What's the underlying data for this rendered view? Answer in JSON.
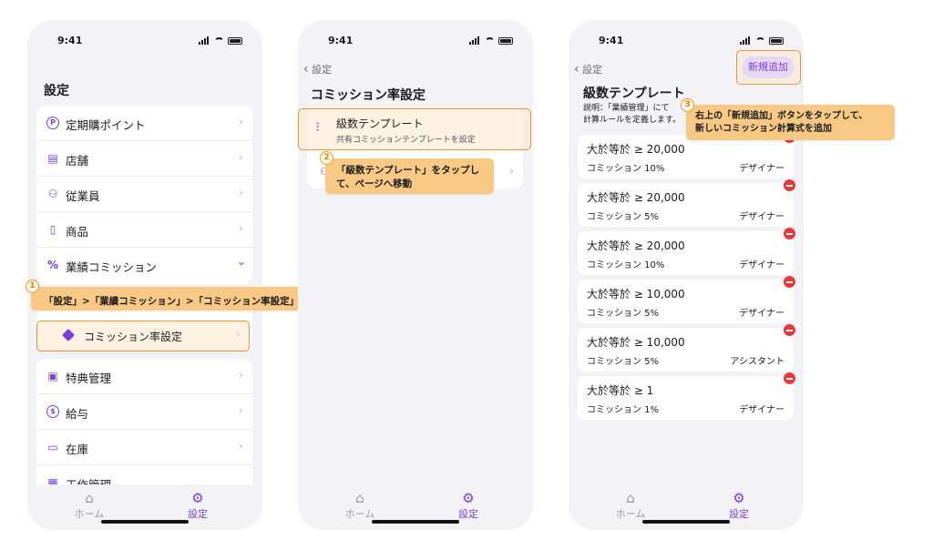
{
  "status_time": "9:41",
  "tabbar": {
    "home": "ホーム",
    "settings": "設定"
  },
  "screen1": {
    "title": "設定",
    "items": [
      {
        "icon": "points-icon",
        "label": "定期購ポイント"
      },
      {
        "icon": "store-icon",
        "label": "店舗"
      },
      {
        "icon": "staff-icon",
        "label": "従業員"
      },
      {
        "icon": "product-icon",
        "label": "商品"
      },
      {
        "icon": "percent-icon",
        "label": "業績コミッション"
      }
    ],
    "sub_item": "コミッション率設定",
    "items2": [
      {
        "icon": "benefit-icon",
        "label": "特典管理"
      },
      {
        "icon": "salary-icon",
        "label": "給与"
      },
      {
        "icon": "inventory-icon",
        "label": "在庫"
      },
      {
        "icon": "work-icon",
        "label": "工作管理"
      }
    ],
    "callout_num": "1",
    "callout": "「設定」>「業績コミッション」>「コミッション率設定」へ移動"
  },
  "screen2": {
    "back": "設定",
    "title": "コミッション率設定",
    "item_title": "級数テンプレート",
    "item_sub": "共有コミッションテンプレートを設定",
    "callout_num": "2",
    "callout_line1": "「級数テンプレート」をタップし",
    "callout_line2": "て、ページへ移動"
  },
  "screen3": {
    "back": "設定",
    "add_button": "新規追加",
    "title": "級数テンプレート",
    "desc_line1": "説明：「業績管理」にて",
    "desc_line2": "計算ルールを定義します。",
    "callout_num": "3",
    "callout_line1": "右上の「新規追加」ボタンをタップして、",
    "callout_line2": "新しいコミッション計算式を追加",
    "rules": [
      {
        "condition": "大於等於 ≥ 20,000",
        "rate": "コミッション 10%",
        "role": "デザイナー"
      },
      {
        "condition": "大於等於 ≥ 20,000",
        "rate": "コミッション 5%",
        "role": "デザイナー"
      },
      {
        "condition": "大於等於 ≥ 20,000",
        "rate": "コミッション 10%",
        "role": "デザイナー"
      },
      {
        "condition": "大於等於 ≥ 10,000",
        "rate": "コミッション 5%",
        "role": "デザイナー"
      },
      {
        "condition": "大於等於 ≥ 10,000",
        "rate": "コミッション 5%",
        "role": "アシスタント"
      },
      {
        "condition": "大於等於 ≥ 1",
        "rate": "コミッション 1%",
        "role": "デザイナー"
      }
    ]
  },
  "colors": {
    "accent": "#7a3fd6",
    "highlight_border": "#e8963a",
    "callout_bg": "#f7c985",
    "delete": "#e5393b"
  }
}
